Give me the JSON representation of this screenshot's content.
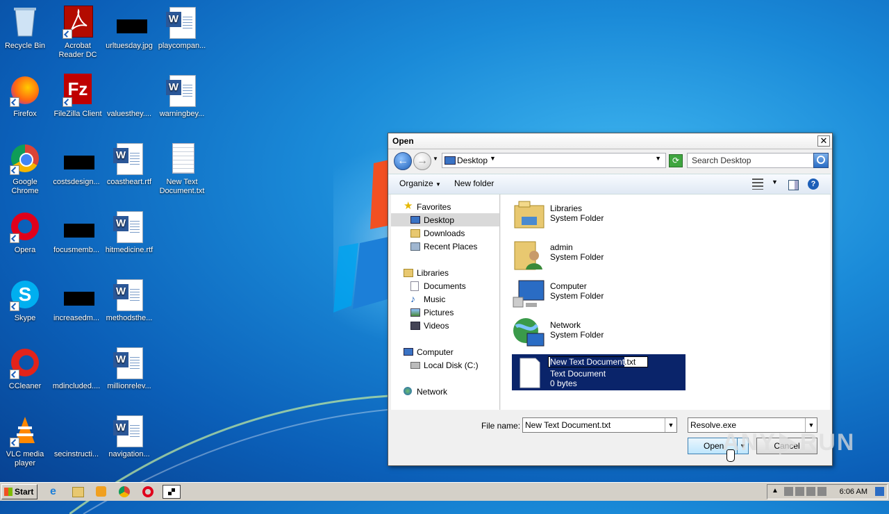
{
  "desktop": {
    "icons": [
      {
        "label": "Recycle Bin"
      },
      {
        "label": "Acrobat Reader DC"
      },
      {
        "label": "urltuesday.jpg"
      },
      {
        "label": "playcompan..."
      },
      {
        "label": "Firefox"
      },
      {
        "label": "FileZilla Client"
      },
      {
        "label": "valuesthey...."
      },
      {
        "label": "warningbey..."
      },
      {
        "label": "Google Chrome"
      },
      {
        "label": "costsdesign..."
      },
      {
        "label": "coastheart.rtf"
      },
      {
        "label": "New Text Document.txt"
      },
      {
        "label": "Opera"
      },
      {
        "label": "focusmemb..."
      },
      {
        "label": "hitmedicine.rtf"
      },
      {
        "label": "Skype"
      },
      {
        "label": "increasedm..."
      },
      {
        "label": "methodsthe..."
      },
      {
        "label": "CCleaner"
      },
      {
        "label": "mdincluded...."
      },
      {
        "label": "millionrelev..."
      },
      {
        "label": "VLC media player"
      },
      {
        "label": "secinstructi..."
      },
      {
        "label": "navigation..."
      }
    ]
  },
  "dialog": {
    "title": "Open",
    "address": "Desktop",
    "search_placeholder": "Search Desktop",
    "toolbar": {
      "organize": "Organize",
      "new_folder": "New folder"
    },
    "nav": {
      "favorites": "Favorites",
      "desktop": "Desktop",
      "downloads": "Downloads",
      "recent": "Recent Places",
      "libraries": "Libraries",
      "documents": "Documents",
      "music": "Music",
      "pictures": "Pictures",
      "videos": "Videos",
      "computer": "Computer",
      "local_disk": "Local Disk (C:)",
      "network": "Network"
    },
    "files": [
      {
        "name": "Libraries",
        "type": "System Folder"
      },
      {
        "name": "admin",
        "type": "System Folder"
      },
      {
        "name": "Computer",
        "type": "System Folder"
      },
      {
        "name": "Network",
        "type": "System Folder"
      },
      {
        "name_selected": "New Text Document",
        "name_ext": ".txt",
        "type": "Text Document",
        "size": "0 bytes"
      }
    ],
    "file_name_label": "File name:",
    "file_name_value": "New Text Document.txt",
    "file_type_value": "Resolve.exe",
    "open_label": "Open",
    "cancel_label": "Cancel",
    "close_glyph": "✕"
  },
  "taskbar": {
    "start_label": "Start",
    "clock": "6:06 AM"
  },
  "watermark": {
    "left": "ANY",
    "right": "RUN"
  }
}
